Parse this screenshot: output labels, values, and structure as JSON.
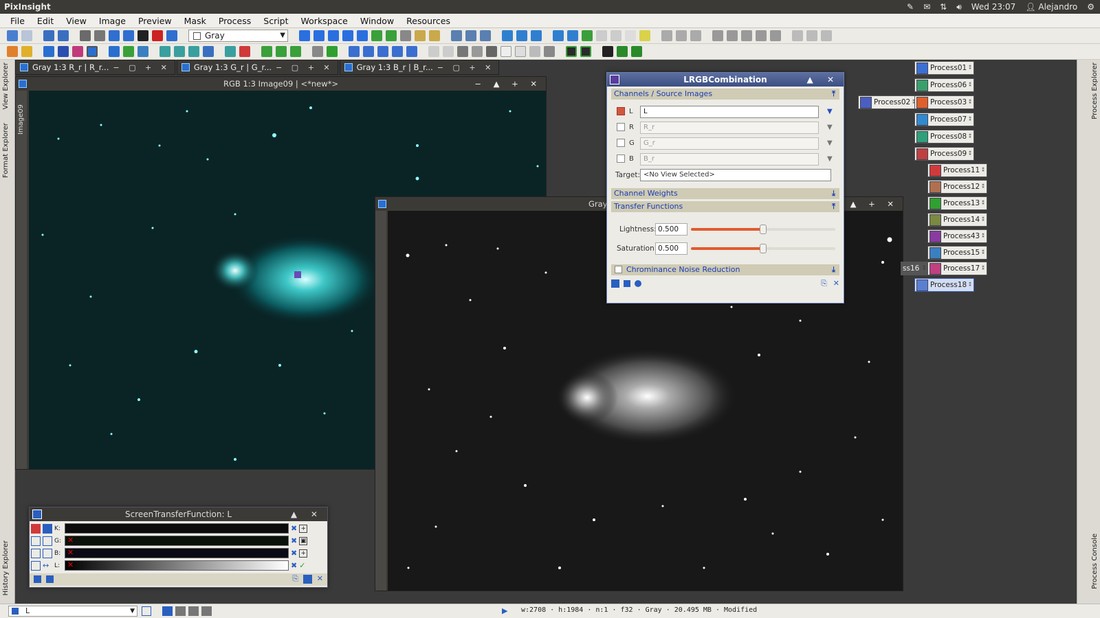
{
  "top_bar": {
    "app_name": "PixInsight",
    "clock": "Wed 23:07",
    "user": "Alejandro"
  },
  "menu": [
    "File",
    "Edit",
    "View",
    "Image",
    "Preview",
    "Mask",
    "Process",
    "Script",
    "Workspace",
    "Window",
    "Resources"
  ],
  "toolbar": {
    "color_space_select": "Gray"
  },
  "side_tabs": {
    "left": [
      "View Explorer",
      "Format Explorer",
      "History Explorer"
    ],
    "right": [
      "Process Explorer",
      "Process Console"
    ],
    "image_tab": "Image09"
  },
  "window_tabs": [
    {
      "label": "Gray 1:3 R_r | R_r..."
    },
    {
      "label": "Gray 1:3 G_r | G_r..."
    },
    {
      "label": "Gray 1:3 B_r | B_r..."
    }
  ],
  "rgb_window": {
    "title": "RGB 1:3 Image09 | <*new*>"
  },
  "gray_window": {
    "title": "Gray"
  },
  "lrgb": {
    "title": "LRGBCombination",
    "section_channels": "Channels / Source Images",
    "channels": [
      {
        "letter": "L",
        "value": "L",
        "checked": true
      },
      {
        "letter": "R",
        "value": "R_r",
        "checked": false
      },
      {
        "letter": "G",
        "value": "G_r",
        "checked": false
      },
      {
        "letter": "B",
        "value": "B_r",
        "checked": false
      }
    ],
    "target_label": "Target:",
    "target_value": "<No View Selected>",
    "section_weights": "Channel Weights",
    "section_transfer": "Transfer Functions",
    "lightness_label": "Lightness:",
    "lightness_value": "0.500",
    "lightness_fraction": 0.5,
    "saturation_label": "Saturation:",
    "saturation_value": "0.500",
    "saturation_fraction": 0.5,
    "section_noise": "Chrominance Noise Reduction"
  },
  "process_icons": [
    {
      "name": "Process01",
      "color": "#3b6fd6"
    },
    {
      "name": "Process06",
      "color": "#3aa06a"
    },
    {
      "name": "Process02",
      "color": "#4a5fc0"
    },
    {
      "name": "Process03",
      "color": "#e0602a"
    },
    {
      "name": "Process07",
      "color": "#2f8ad0"
    },
    {
      "name": "Process08",
      "color": "#2fa07a"
    },
    {
      "name": "Process09",
      "color": "#c04040"
    },
    {
      "name": "Process11",
      "color": "#d03a3a"
    },
    {
      "name": "Process12",
      "color": "#b07050"
    },
    {
      "name": "Process13",
      "color": "#30a030"
    },
    {
      "name": "Process14",
      "color": "#7a8a40"
    },
    {
      "name": "Process43",
      "color": "#8a3aa0"
    },
    {
      "name": "Process15",
      "color": "#3a80c0"
    },
    {
      "name": "ss16",
      "color": "#666666"
    },
    {
      "name": "Process17",
      "color": "#c04080"
    },
    {
      "name": "Process18",
      "color": "#5a7fd0"
    }
  ],
  "stf": {
    "title": "ScreenTransferFunction: L",
    "rows": [
      "K:",
      "G:",
      "B:",
      "L:"
    ]
  },
  "status": {
    "view_select": "L",
    "info": "w:2708 · h:1984 · n:1 · f32 · Gray · 20.495 MB · Modified"
  }
}
